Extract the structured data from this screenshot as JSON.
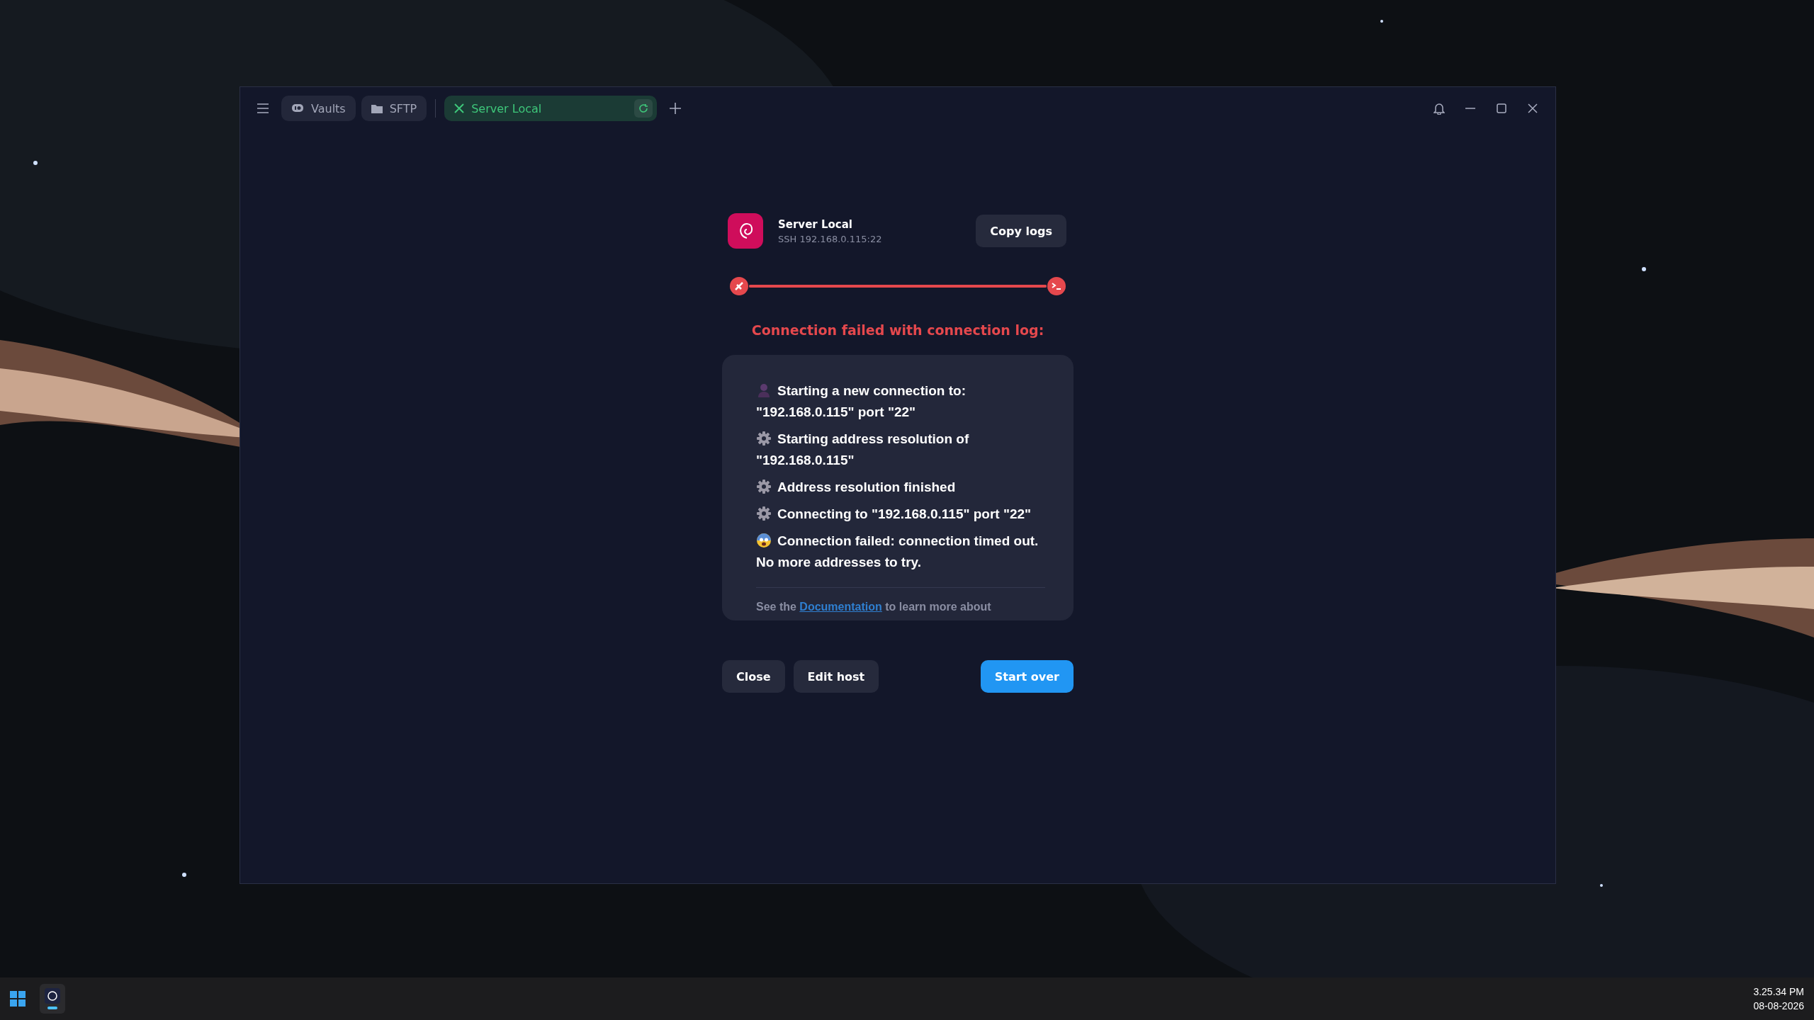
{
  "tabs": [
    {
      "label": "Vaults",
      "kind": "vaults",
      "selected": false
    },
    {
      "label": "SFTP",
      "kind": "folder",
      "selected": false
    },
    {
      "label": "Server Local",
      "kind": "session",
      "selected": true
    }
  ],
  "host": {
    "name": "Server Local",
    "address": "SSH 192.168.0.115:22"
  },
  "copy_button": "Copy logs",
  "progress": {
    "level": 1
  },
  "error_title": "Connection failed with connection log:",
  "log": [
    {
      "kind": "person",
      "text": "Starting a new connection to: \"192.168.0.115\" port \"22\""
    },
    {
      "kind": "gear",
      "text": "Starting address resolution of \"192.168.0.115\""
    },
    {
      "kind": "gear",
      "text": "Address resolution finished"
    },
    {
      "kind": "gear",
      "text": "Connecting to \"192.168.0.115\" port \"22\""
    },
    {
      "kind": "scared",
      "text": "Connection failed: connection timed out. No more addresses to try."
    }
  ],
  "help": {
    "before": "See the ",
    "link": "Documentation",
    "after": " to learn more about"
  },
  "buttons": [
    {
      "label": "Close",
      "kind": "secondary"
    },
    {
      "label": "Edit host",
      "kind": "secondary"
    },
    {
      "label": "Start over",
      "kind": "primary"
    }
  ],
  "taskbar": {
    "time": "3.25.34 PM",
    "date": "08-08-2026"
  }
}
